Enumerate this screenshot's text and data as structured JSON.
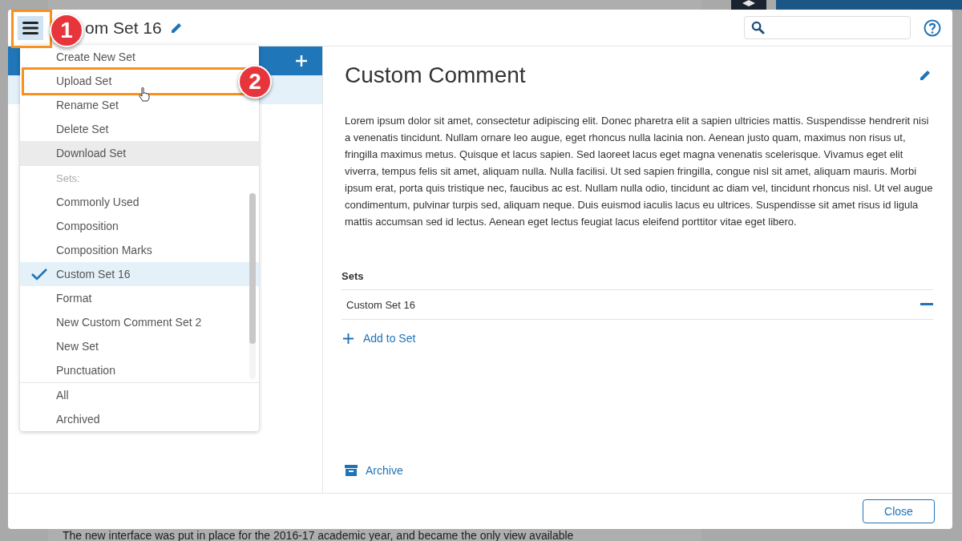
{
  "background_text": "The new interface was put in place for the 2016-17 academic year, and became the only view available",
  "header": {
    "title": "om Set 16"
  },
  "menu": {
    "actions": [
      {
        "label": "Create New Set",
        "highlighted": false
      },
      {
        "label": "Upload Set",
        "highlighted": false
      },
      {
        "label": "Rename Set",
        "highlighted": false
      },
      {
        "label": "Delete Set",
        "highlighted": false
      },
      {
        "label": "Download Set",
        "highlighted": true
      }
    ],
    "sets_heading": "Sets:",
    "sets": [
      {
        "label": "Commonly Used",
        "selected": false
      },
      {
        "label": "Composition",
        "selected": false
      },
      {
        "label": "Composition Marks",
        "selected": false
      },
      {
        "label": "Custom Set 16",
        "selected": true
      },
      {
        "label": "Format",
        "selected": false
      },
      {
        "label": "New Custom Comment Set 2",
        "selected": false
      },
      {
        "label": "New Set",
        "selected": false
      },
      {
        "label": "Punctuation",
        "selected": false
      }
    ],
    "filters": [
      {
        "label": "All"
      },
      {
        "label": "Archived"
      }
    ]
  },
  "annotations": [
    {
      "number": "1"
    },
    {
      "number": "2"
    }
  ],
  "comment": {
    "title": "Custom Comment",
    "body": "Lorem ipsum dolor sit amet, consectetur adipiscing elit. Donec pharetra elit a sapien ultricies mattis. Suspendisse hendrerit nisi a venenatis tincidunt. Nullam ornare leo augue, eget rhoncus nulla lacinia non. Aenean justo quam, maximus non risus ut, fringilla maximus metus. Quisque et lacus sapien. Sed laoreet lacus eget magna venenatis scelerisque. Vivamus eget elit viverra, tempus felis sit amet, aliquam nulla. Nulla facilisi. Ut sed sapien fringilla, congue nisl sit amet, aliquam mauris. Morbi ipsum erat, porta quis tristique nec, faucibus ac est. Nullam nulla odio, tincidunt ac diam vel, tincidunt rhoncus nisl. Ut vel augue condimentum, pulvinar turpis sed, aliquam neque. Duis euismod iaculis lacus eu ultrices. Suspendisse sit amet risus id ligula mattis accumsan sed id lectus. Aenean eget lectus feugiat lacus eleifend porttitor vitae eget libero."
  },
  "sets_section": {
    "heading": "Sets",
    "rows": [
      {
        "label": "Custom Set 16"
      }
    ],
    "add_label": "Add to Set"
  },
  "archive_label": "Archive",
  "close_button": "Close"
}
